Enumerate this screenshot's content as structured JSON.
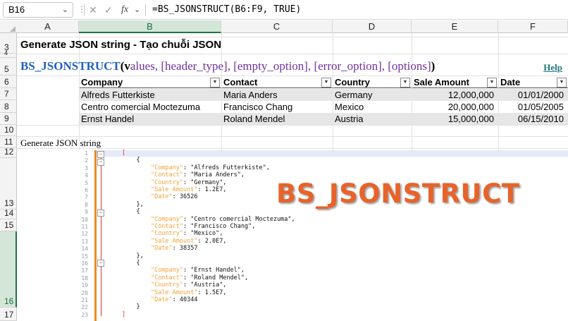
{
  "formula_bar": {
    "name_box": "B16",
    "cancel_icon": "✕",
    "confirm_icon": "✓",
    "fx_label": "fx",
    "formula": "=BS_JSONSTRUCT(B6:F9, TRUE)"
  },
  "columns": [
    "A",
    "B",
    "C",
    "D",
    "E",
    "F"
  ],
  "rows": [
    "3",
    "4",
    "5",
    "6",
    "7",
    "8",
    "9",
    "10",
    "11",
    "12",
    "13",
    "14",
    "15",
    "16",
    "17"
  ],
  "partial_rows": {
    "top": "1"
  },
  "sheet": {
    "title": "Generate JSON string - Tạo chuỗi JSON",
    "syntax": {
      "function": "BS_JSONSTRUCT",
      "open": "(",
      "first_char": "v",
      "params": "alues, [header_type], [empty_option], [error_option], [options]",
      "close": ")"
    },
    "help_link": "Help",
    "row11_label": "Generate JSON string"
  },
  "table": {
    "headers": [
      "Company",
      "Contact",
      "Country",
      "Sale Amount",
      "Date"
    ],
    "rows": [
      [
        "Alfreds Futterkiste",
        "Maria Anders",
        "Germany",
        "12,000,000",
        "01/01/2000"
      ],
      [
        "Centro comercial Moctezuma",
        "Francisco Chang",
        "Mexico",
        "20,000,000",
        "01/05/2005"
      ],
      [
        "Ernst Handel",
        "Roland Mendel",
        "Austria",
        "15,000,000",
        "06/15/2010"
      ]
    ]
  },
  "code": {
    "line_numbers": [
      "1",
      "2",
      "3",
      "4",
      "5",
      "6",
      "7",
      "8",
      "9",
      "10",
      "11",
      "12",
      "13",
      "14",
      "15",
      "16",
      "17",
      "18",
      "19",
      "20",
      "21",
      "22",
      "23"
    ],
    "lines": [
      "[",
      "    {",
      "        \"Company\": \"Alfreds Futterkiste\",",
      "        \"Contact\": \"Maria Anders\",",
      "        \"Country\": \"Germany\",",
      "        \"Sale Amount\": 1.2E7,",
      "        \"Date\": 36526",
      "    },",
      "    {",
      "        \"Company\": \"Centro comercial Moctezuma\",",
      "        \"Contact\": \"Francisco Chang\",",
      "        \"Country\": \"Mexico\",",
      "        \"Sale Amount\": 2.0E7,",
      "        \"Date\": 38357",
      "    },",
      "    {",
      "        \"Company\": \"Ernst Handel\",",
      "        \"Contact\": \"Roland Mendel\",",
      "        \"Country\": \"Austria\",",
      "        \"Sale Amount\": 1.5E7,",
      "        \"Date\": 40344",
      "    }",
      "]"
    ],
    "banner": "BS_JSONSTRUCT",
    "colors": {
      "key": "#f2a23a",
      "banner": "#e8632a",
      "fold_bar": "#f08a1e"
    }
  },
  "colors": {
    "excel_green": "#217346",
    "syntax_fn": "#1f5fbf",
    "syntax_params": "#7030a0"
  }
}
